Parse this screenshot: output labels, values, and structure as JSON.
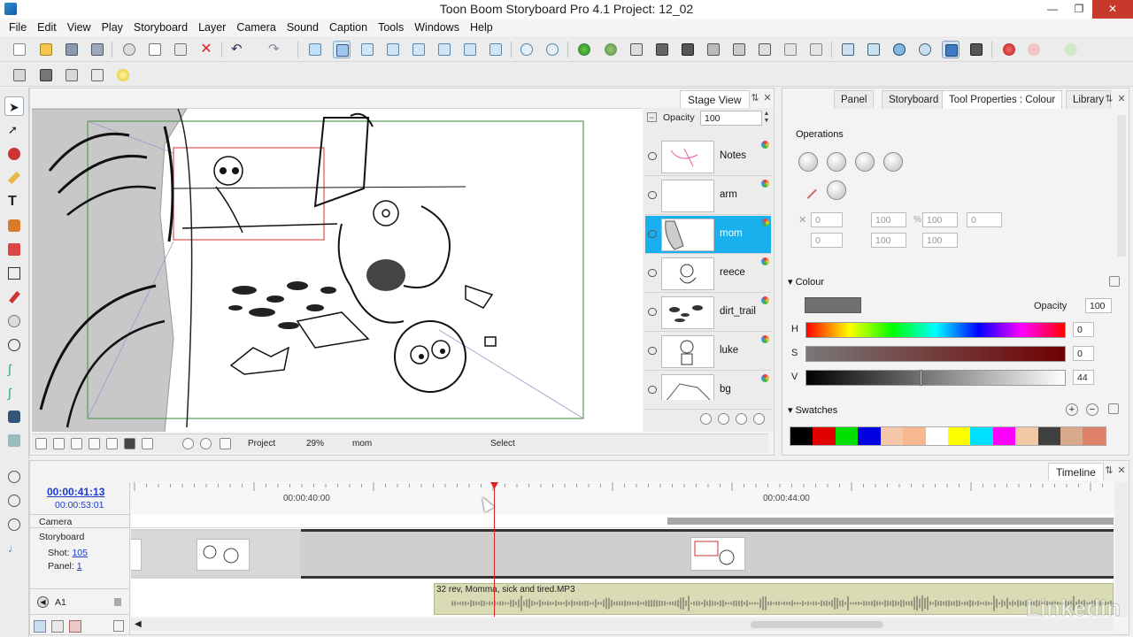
{
  "app": {
    "title": "Toon Boom Storyboard Pro 4.1 Project: 12_02"
  },
  "window_buttons": {
    "minimize": "—",
    "maximize": "❐",
    "close": "✕"
  },
  "menu": [
    "File",
    "Edit",
    "View",
    "Play",
    "Storyboard",
    "Layer",
    "Camera",
    "Sound",
    "Caption",
    "Tools",
    "Windows",
    "Help"
  ],
  "stage": {
    "tab": "Stage View",
    "opacity_label": "Opacity",
    "opacity_value": "100",
    "status_view": "Project",
    "status_zoom": "29%",
    "status_layer": "mom",
    "status_tool": "Select"
  },
  "layers": [
    {
      "name": "Notes",
      "selected": false
    },
    {
      "name": "arm",
      "selected": false
    },
    {
      "name": "mom",
      "selected": true
    },
    {
      "name": "reece",
      "selected": false
    },
    {
      "name": "dirt_trail",
      "selected": false
    },
    {
      "name": "luke",
      "selected": false
    },
    {
      "name": "bg",
      "selected": false
    }
  ],
  "right_panel": {
    "tabs": [
      "Panel",
      "Storyboard",
      "Tool Properties : Colour",
      "Library"
    ],
    "active_tab": "Tool Properties : Colour",
    "operations_label": "Operations",
    "fields": {
      "x": "0",
      "y": "0",
      "w": "100",
      "h": "100",
      "rot": "0",
      "percent": "%"
    },
    "colour_label": "Colour",
    "opacity_label": "Opacity",
    "opacity_value": "100",
    "h_label": "H",
    "h_value": "0",
    "s_label": "S",
    "s_value": "0",
    "v_label": "V",
    "v_value": "44",
    "swatches_label": "Swatches",
    "current_colour": "#707070",
    "swatch_colors": [
      "#000000",
      "#e00000",
      "#00e000",
      "#0000e0",
      "#f4c7a8",
      "#f7b890",
      "#ffffff",
      "#ffff00",
      "#00e0ff",
      "#ff00ff",
      "#f1c9a5",
      "#404040",
      "#d9a98b",
      "#e0826a"
    ]
  },
  "timeline": {
    "tab": "Timeline",
    "current_time": "00:00:41:13",
    "total_time": "00:00:53:01",
    "ruler_labels": [
      "00:00:40:00",
      "00:00:44:00"
    ],
    "camera_label": "Camera",
    "storyboard_label": "Storyboard",
    "shot_label": "Shot:",
    "shot_value": "105",
    "panel_label": "Panel:",
    "panel_value": "1",
    "audio_track": "A1",
    "audio_clip": "32 rev, Momma, sick and tired.MP3"
  },
  "watermark": "LinkedIn"
}
